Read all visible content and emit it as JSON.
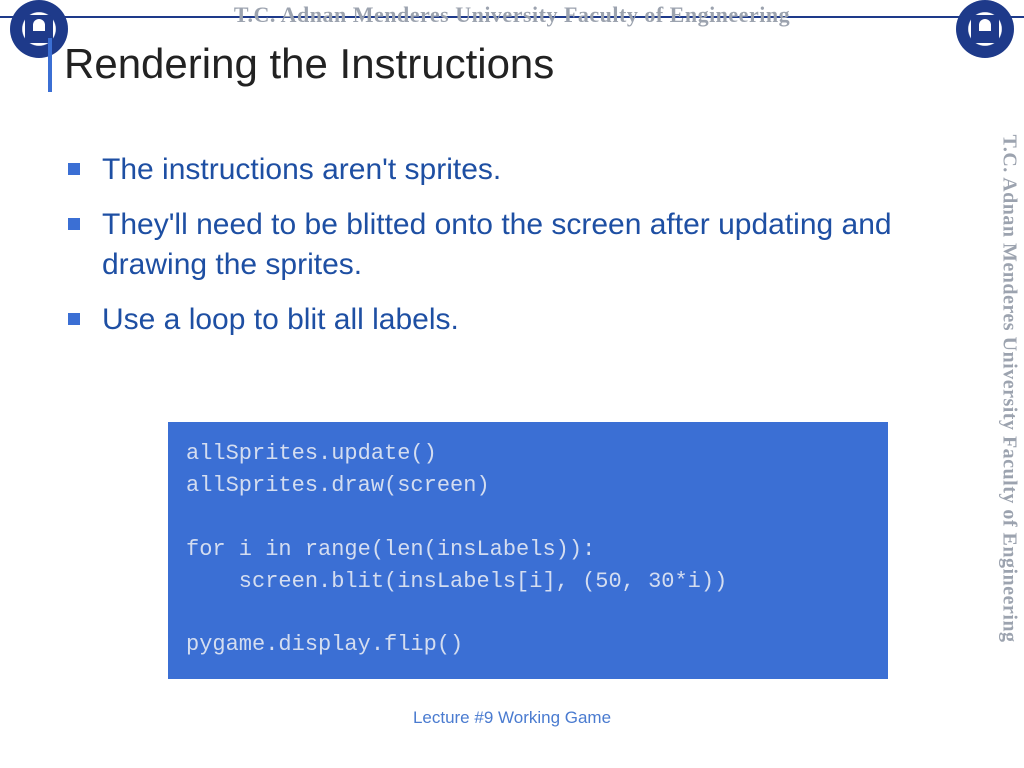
{
  "header": {
    "watermark": "T.C.    Adnan Menderes University    Faculty of Engineering"
  },
  "slide": {
    "title": "Rendering the Instructions",
    "bullets": [
      "The instructions aren't sprites.",
      "They'll need to be blitted onto the screen after updating and drawing the sprites.",
      "Use a loop to blit all labels."
    ],
    "code": "allSprites.update()\nallSprites.draw(screen)\n\nfor i in range(len(insLabels)):\n    screen.blit(insLabels[i], (50, 30*i))\n\npygame.display.flip()",
    "footer": "Lecture #9 Working Game"
  },
  "side_watermark": "T.C.    Adnan Menderes University    Faculty of Engineering"
}
